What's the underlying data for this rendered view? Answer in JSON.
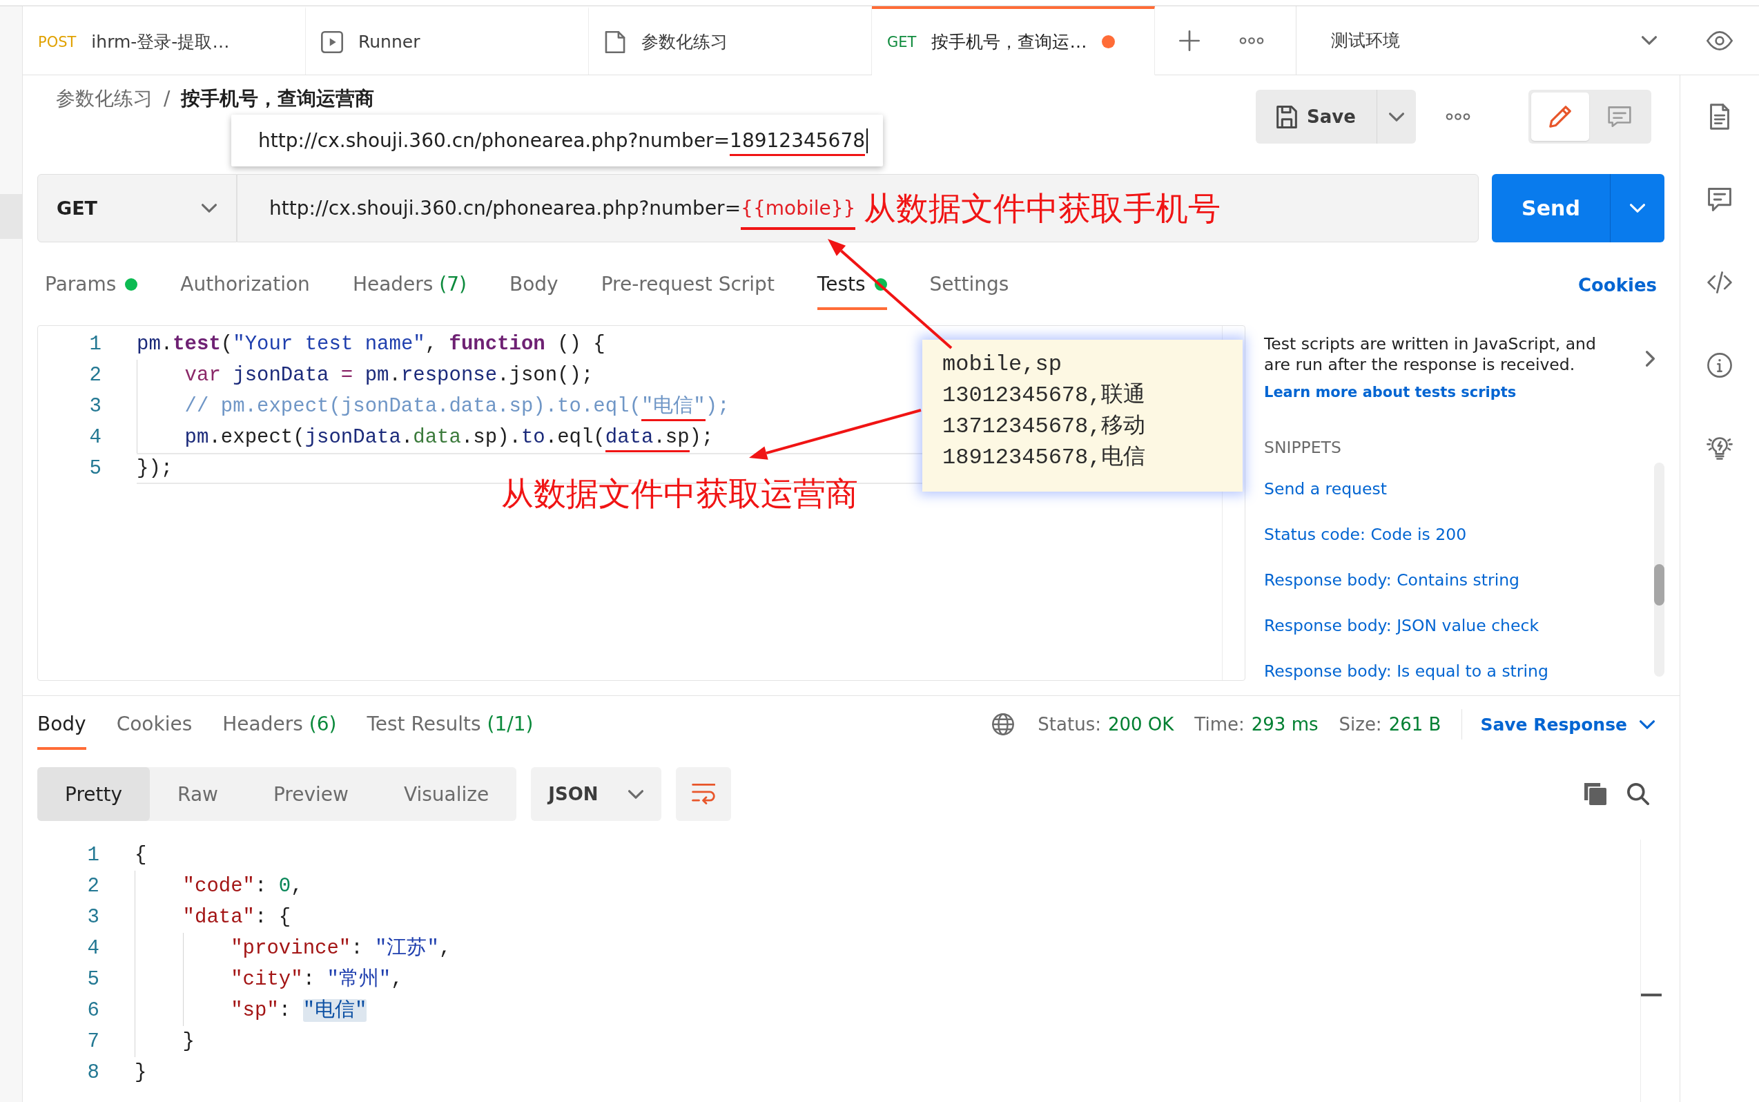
{
  "tabs": [
    {
      "kind": "request",
      "method": "POST",
      "color": "#e0a100",
      "label": "ihrm-登录-提取…",
      "selected": false,
      "unsaved": false
    },
    {
      "kind": "runner",
      "label": "Runner",
      "selected": false,
      "unsaved": false
    },
    {
      "kind": "collection",
      "label": "参数化练习",
      "selected": false,
      "unsaved": false
    },
    {
      "kind": "request",
      "method": "GET",
      "color": "#0f8b3d",
      "label": "按手机号，查询运…",
      "selected": true,
      "unsaved": true
    }
  ],
  "environment": {
    "label": "测试环境"
  },
  "toolbar": {
    "breadcrumb": {
      "separator": "/",
      "items": [
        {
          "label": "参数化练习",
          "current": false
        },
        {
          "label": "按手机号，查询运营商",
          "current": true
        }
      ]
    },
    "save": "Save",
    "modes": [
      {
        "kind": "edit",
        "selected": true
      },
      {
        "kind": "comments",
        "selected": false
      }
    ]
  },
  "tooltip": {
    "segments": [
      {
        "text": "http://cx.shouji.360.cn/phonearea.php?number=",
        "kind": "plain",
        "marked": false
      },
      {
        "text": "18912345678",
        "kind": "plain",
        "marked": true
      }
    ],
    "cursor": true
  },
  "request": {
    "method": "GET",
    "url": [
      {
        "text": "http://cx.shouji.360.cn/phonearea.php?number=",
        "kind": "plain",
        "marked": false
      },
      {
        "text": "{{mobile}}",
        "kind": "variable",
        "marked": true
      }
    ],
    "annotation": "从数据文件中获取手机号",
    "send": "Send"
  },
  "request_tabs": {
    "items": [
      {
        "label": "Params",
        "indicator": true,
        "selected": false
      },
      {
        "label": "Authorization",
        "indicator": false,
        "selected": false
      },
      {
        "label": "Headers",
        "count": "(7)",
        "indicator": false,
        "selected": false
      },
      {
        "label": "Body",
        "indicator": false,
        "selected": false
      },
      {
        "label": "Pre-request Script",
        "indicator": false,
        "selected": false
      },
      {
        "label": "Tests",
        "indicator": true,
        "selected": true
      },
      {
        "label": "Settings",
        "indicator": false,
        "selected": false
      }
    ],
    "cookies": "Cookies"
  },
  "editor": {
    "lines": [
      {
        "number": "1",
        "current": false,
        "tokens": [
          {
            "text": "pm",
            "kind": "ident",
            "marked": false
          },
          {
            "text": ".",
            "kind": "plain",
            "marked": false
          },
          {
            "text": "test",
            "kind": "method",
            "marked": false
          },
          {
            "text": "(",
            "kind": "plain",
            "marked": false
          },
          {
            "text": "\"Your test name\"",
            "kind": "string",
            "marked": false
          },
          {
            "text": ", ",
            "kind": "plain",
            "marked": false
          },
          {
            "text": "function",
            "kind": "keyword",
            "marked": false
          },
          {
            "text": " () {",
            "kind": "plain",
            "marked": false
          }
        ]
      },
      {
        "number": "2",
        "current": false,
        "tokens": [
          {
            "kind": "indent"
          },
          {
            "text": "var",
            "kind": "storage",
            "marked": false
          },
          {
            "text": " jsonData",
            "kind": "ident",
            "marked": false
          },
          {
            "text": " = ",
            "kind": "operator",
            "marked": false
          },
          {
            "text": "pm",
            "kind": "ident",
            "marked": false
          },
          {
            "text": ".",
            "kind": "plain",
            "marked": false
          },
          {
            "text": "response",
            "kind": "ident",
            "marked": false
          },
          {
            "text": ".json();",
            "kind": "plain",
            "marked": false
          }
        ]
      },
      {
        "number": "3",
        "current": false,
        "tokens": [
          {
            "kind": "indent"
          },
          {
            "text": "// pm.expect(jsonData.data.sp).to.eql(",
            "kind": "comment",
            "marked": false
          },
          {
            "text": "\"电信\"",
            "kind": "comment",
            "marked": true
          },
          {
            "text": ");",
            "kind": "comment",
            "marked": false
          }
        ]
      },
      {
        "number": "4",
        "current": false,
        "tokens": [
          {
            "kind": "indent"
          },
          {
            "text": "pm",
            "kind": "ident",
            "marked": false
          },
          {
            "text": ".expect(",
            "kind": "plain",
            "marked": false
          },
          {
            "text": "jsonData",
            "kind": "ident",
            "marked": false
          },
          {
            "text": ".",
            "kind": "plain",
            "marked": false
          },
          {
            "text": "data",
            "kind": "property",
            "marked": false
          },
          {
            "text": ".sp).",
            "kind": "plain",
            "marked": false
          },
          {
            "text": "to",
            "kind": "ident",
            "marked": false
          },
          {
            "text": ".eql(",
            "kind": "plain",
            "marked": false
          },
          {
            "text": "data",
            "kind": "ident",
            "marked": true
          },
          {
            "text": ".sp",
            "kind": "plain",
            "marked": true
          },
          {
            "text": ");",
            "kind": "plain",
            "marked": false
          }
        ]
      },
      {
        "number": "5",
        "current": true,
        "tokens": [
          {
            "text": "});",
            "kind": "plain",
            "marked": false
          }
        ]
      }
    ],
    "annotation": "从数据文件中获取运营商"
  },
  "data_note": {
    "lines": [
      "mobile,sp",
      "13012345678,联通",
      "13712345678,移动",
      "18912345678,电信"
    ]
  },
  "help": {
    "description": "Test scripts are written in JavaScript, and are run after the response is received.",
    "link": "Learn more about tests scripts",
    "heading": "SNIPPETS",
    "snippets": [
      "Send a request",
      "Status code: Code is 200",
      "Response body: Contains string",
      "Response body: JSON value check",
      "Response body: Is equal to a string"
    ]
  },
  "response": {
    "tabs": [
      {
        "label": "Body",
        "selected": true
      },
      {
        "label": "Cookies",
        "selected": false
      },
      {
        "label": "Headers",
        "count": "(6)",
        "selected": false
      },
      {
        "label": "Test Results",
        "count": "(1/1)",
        "selected": false
      }
    ],
    "meta": [
      {
        "label": "Status:",
        "value": "200 OK"
      },
      {
        "label": "Time:",
        "value": "293 ms"
      },
      {
        "label": "Size:",
        "value": "261 B"
      }
    ],
    "save_response": "Save Response",
    "formats": [
      {
        "label": "Pretty",
        "selected": true
      },
      {
        "label": "Raw",
        "selected": false
      },
      {
        "label": "Preview",
        "selected": false
      },
      {
        "label": "Visualize",
        "selected": false
      }
    ],
    "language": "JSON",
    "wrap": {
      "on": true
    },
    "lines": [
      {
        "number": "1",
        "tokens": [
          {
            "text": "{",
            "kind": "plain"
          }
        ]
      },
      {
        "number": "2",
        "tokens": [
          {
            "kind": "indent"
          },
          {
            "text": "\"code\"",
            "kind": "key"
          },
          {
            "text": ": ",
            "kind": "plain"
          },
          {
            "text": "0",
            "kind": "number"
          },
          {
            "text": ",",
            "kind": "plain"
          }
        ]
      },
      {
        "number": "3",
        "tokens": [
          {
            "kind": "indent"
          },
          {
            "text": "\"data\"",
            "kind": "key"
          },
          {
            "text": ": {",
            "kind": "plain"
          }
        ]
      },
      {
        "number": "4",
        "tokens": [
          {
            "kind": "indent"
          },
          {
            "kind": "indent"
          },
          {
            "text": "\"province\"",
            "kind": "key"
          },
          {
            "text": ": ",
            "kind": "plain"
          },
          {
            "text": "\"江苏\"",
            "kind": "string"
          },
          {
            "text": ",",
            "kind": "plain"
          }
        ]
      },
      {
        "number": "5",
        "tokens": [
          {
            "kind": "indent"
          },
          {
            "kind": "indent"
          },
          {
            "text": "\"city\"",
            "kind": "key"
          },
          {
            "text": ": ",
            "kind": "plain"
          },
          {
            "text": "\"常州\"",
            "kind": "string"
          },
          {
            "text": ",",
            "kind": "plain"
          }
        ]
      },
      {
        "number": "6",
        "tokens": [
          {
            "kind": "indent"
          },
          {
            "kind": "indent"
          },
          {
            "text": "\"sp\"",
            "kind": "key"
          },
          {
            "text": ": ",
            "kind": "plain"
          },
          {
            "text": "\"电信\"",
            "kind": "match"
          }
        ]
      },
      {
        "number": "7",
        "tokens": [
          {
            "kind": "indent"
          },
          {
            "text": "}",
            "kind": "plain"
          }
        ]
      },
      {
        "number": "8",
        "tokens": [
          {
            "text": "}",
            "kind": "plain"
          }
        ]
      }
    ]
  }
}
